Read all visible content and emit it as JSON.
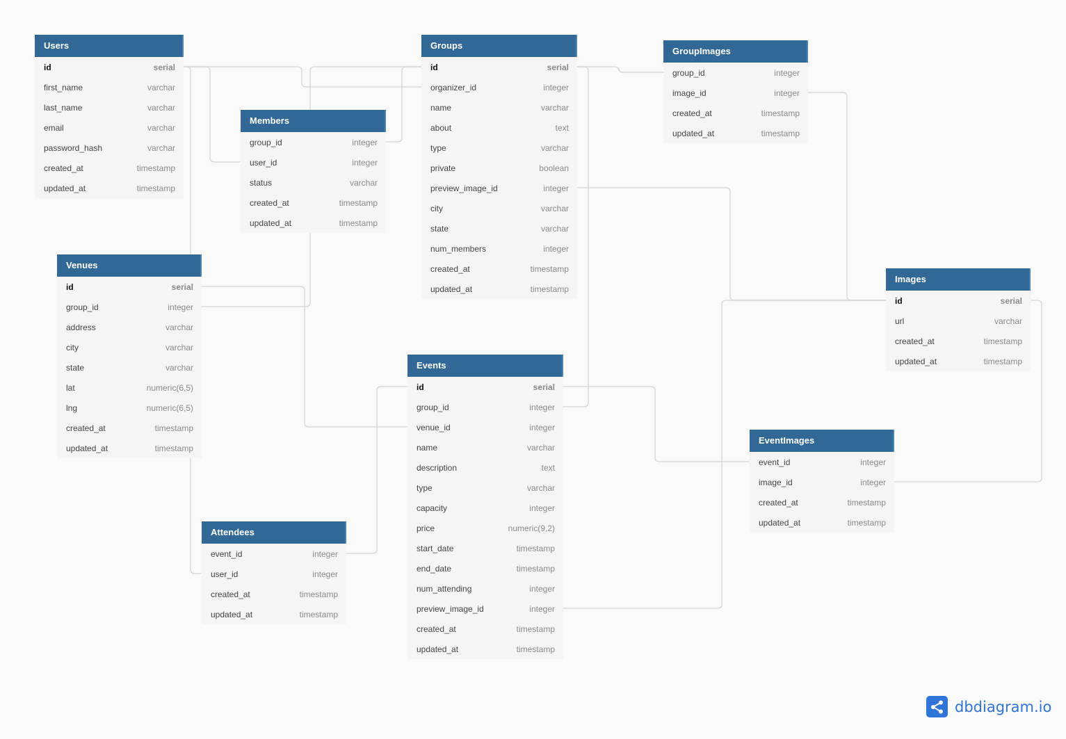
{
  "tables": {
    "users": {
      "title": "Users",
      "columns": [
        {
          "name": "id",
          "type": "serial"
        },
        {
          "name": "first_name",
          "type": "varchar"
        },
        {
          "name": "last_name",
          "type": "varchar"
        },
        {
          "name": "email",
          "type": "varchar"
        },
        {
          "name": "password_hash",
          "type": "varchar"
        },
        {
          "name": "created_at",
          "type": "timestamp"
        },
        {
          "name": "updated_at",
          "type": "timestamp"
        }
      ]
    },
    "members": {
      "title": "Members",
      "columns": [
        {
          "name": "group_id",
          "type": "integer"
        },
        {
          "name": "user_id",
          "type": "integer"
        },
        {
          "name": "status",
          "type": "varchar"
        },
        {
          "name": "created_at",
          "type": "timestamp"
        },
        {
          "name": "updated_at",
          "type": "timestamp"
        }
      ]
    },
    "groups": {
      "title": "Groups",
      "columns": [
        {
          "name": "id",
          "type": "serial"
        },
        {
          "name": "organizer_id",
          "type": "integer"
        },
        {
          "name": "name",
          "type": "varchar"
        },
        {
          "name": "about",
          "type": "text"
        },
        {
          "name": "type",
          "type": "varchar"
        },
        {
          "name": "private",
          "type": "boolean"
        },
        {
          "name": "preview_image_id",
          "type": "integer"
        },
        {
          "name": "city",
          "type": "varchar"
        },
        {
          "name": "state",
          "type": "varchar"
        },
        {
          "name": "num_members",
          "type": "integer"
        },
        {
          "name": "created_at",
          "type": "timestamp"
        },
        {
          "name": "updated_at",
          "type": "timestamp"
        }
      ]
    },
    "groupimages": {
      "title": "GroupImages",
      "columns": [
        {
          "name": "group_id",
          "type": "integer"
        },
        {
          "name": "image_id",
          "type": "integer"
        },
        {
          "name": "created_at",
          "type": "timestamp"
        },
        {
          "name": "updated_at",
          "type": "timestamp"
        }
      ]
    },
    "venues": {
      "title": "Venues",
      "columns": [
        {
          "name": "id",
          "type": "serial"
        },
        {
          "name": "group_id",
          "type": "integer"
        },
        {
          "name": "address",
          "type": "varchar"
        },
        {
          "name": "city",
          "type": "varchar"
        },
        {
          "name": "state",
          "type": "varchar"
        },
        {
          "name": "lat",
          "type": "numeric(6,5)"
        },
        {
          "name": "lng",
          "type": "numeric(6,5)"
        },
        {
          "name": "created_at",
          "type": "timestamp"
        },
        {
          "name": "updated_at",
          "type": "timestamp"
        }
      ]
    },
    "images": {
      "title": "Images",
      "columns": [
        {
          "name": "id",
          "type": "serial"
        },
        {
          "name": "url",
          "type": "varchar"
        },
        {
          "name": "created_at",
          "type": "timestamp"
        },
        {
          "name": "updated_at",
          "type": "timestamp"
        }
      ]
    },
    "events": {
      "title": "Events",
      "columns": [
        {
          "name": "id",
          "type": "serial"
        },
        {
          "name": "group_id",
          "type": "integer"
        },
        {
          "name": "venue_id",
          "type": "integer"
        },
        {
          "name": "name",
          "type": "varchar"
        },
        {
          "name": "description",
          "type": "text"
        },
        {
          "name": "type",
          "type": "varchar"
        },
        {
          "name": "capacity",
          "type": "integer"
        },
        {
          "name": "price",
          "type": "numeric(9,2)"
        },
        {
          "name": "start_date",
          "type": "timestamp"
        },
        {
          "name": "end_date",
          "type": "timestamp"
        },
        {
          "name": "num_attending",
          "type": "integer"
        },
        {
          "name": "preview_image_id",
          "type": "integer"
        },
        {
          "name": "created_at",
          "type": "timestamp"
        },
        {
          "name": "updated_at",
          "type": "timestamp"
        }
      ]
    },
    "eventimages": {
      "title": "EventImages",
      "columns": [
        {
          "name": "event_id",
          "type": "integer"
        },
        {
          "name": "image_id",
          "type": "integer"
        },
        {
          "name": "created_at",
          "type": "timestamp"
        },
        {
          "name": "updated_at",
          "type": "timestamp"
        }
      ]
    },
    "attendees": {
      "title": "Attendees",
      "columns": [
        {
          "name": "event_id",
          "type": "integer"
        },
        {
          "name": "user_id",
          "type": "integer"
        },
        {
          "name": "created_at",
          "type": "timestamp"
        },
        {
          "name": "updated_at",
          "type": "timestamp"
        }
      ]
    }
  },
  "relationships": [
    {
      "from": "users.id",
      "to": "groups.organizer_id"
    },
    {
      "from": "users.id",
      "to": "members.user_id"
    },
    {
      "from": "users.id",
      "to": "attendees.user_id"
    },
    {
      "from": "groups.id",
      "to": "members.group_id"
    },
    {
      "from": "groups.id",
      "to": "venues.group_id"
    },
    {
      "from": "groups.id",
      "to": "groupimages.group_id"
    },
    {
      "from": "groups.id",
      "to": "events.group_id"
    },
    {
      "from": "images.id",
      "to": "groups.preview_image_id"
    },
    {
      "from": "images.id",
      "to": "groupimages.image_id"
    },
    {
      "from": "images.id",
      "to": "events.preview_image_id"
    },
    {
      "from": "images.id",
      "to": "eventimages.image_id"
    },
    {
      "from": "venues.id",
      "to": "events.venue_id"
    },
    {
      "from": "events.id",
      "to": "attendees.event_id"
    },
    {
      "from": "events.id",
      "to": "eventimages.event_id"
    }
  ],
  "branding": {
    "logo_text": "dbdiagram.io",
    "accent": "#2f74d9",
    "header_color": "#316896"
  }
}
